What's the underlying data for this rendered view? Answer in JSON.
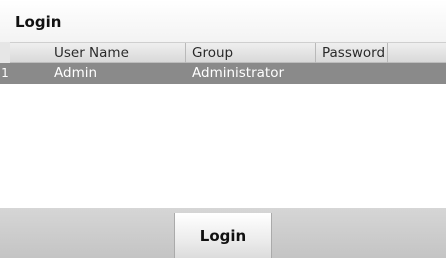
{
  "window": {
    "title": "Login"
  },
  "table": {
    "columns": [
      "User Name",
      "Group",
      "Password"
    ],
    "rows": [
      {
        "index": "1",
        "user_name": "Admin",
        "group": "Administrator",
        "password": ""
      }
    ]
  },
  "footer": {
    "login_label": "Login"
  },
  "colors": {
    "selected_row": "#8a8a8a",
    "footer": "#cccccc",
    "header": "#e0e0e0"
  }
}
